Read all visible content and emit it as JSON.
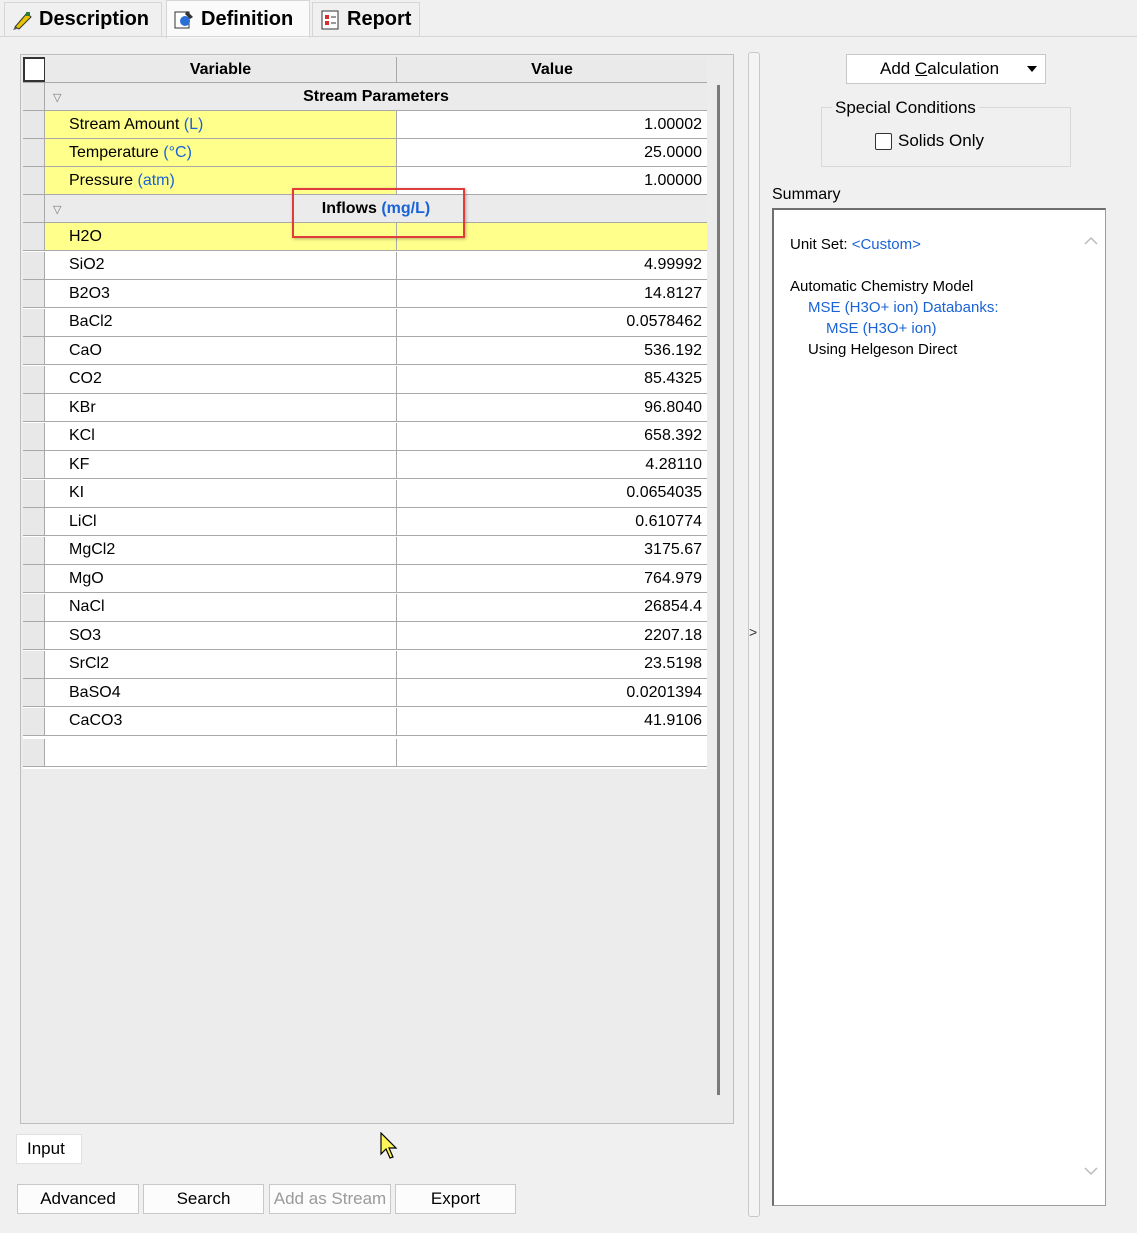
{
  "tabs": [
    {
      "label": "Description",
      "icon": "pencil-tag-icon"
    },
    {
      "label": "Definition",
      "icon": "definition-icon"
    },
    {
      "label": "Report",
      "icon": "report-icon"
    }
  ],
  "grid": {
    "col_variable": "Variable",
    "col_value": "Value",
    "section1": "Stream Parameters",
    "params": [
      {
        "name": "Stream Amount",
        "unit": "(L)",
        "value": "1.00002"
      },
      {
        "name": "Temperature",
        "unit": "(°C)",
        "value": "25.0000"
      },
      {
        "name": "Pressure",
        "unit": "(atm)",
        "value": "1.00000"
      }
    ],
    "section2_label": "Inflows",
    "section2_unit": "(mg/L)",
    "inflows": [
      {
        "name": "H2O",
        "value": ""
      },
      {
        "name": "SiO2",
        "value": "4.99992"
      },
      {
        "name": "B2O3",
        "value": "14.8127"
      },
      {
        "name": "BaCl2",
        "value": "0.0578462"
      },
      {
        "name": "CaO",
        "value": "536.192"
      },
      {
        "name": "CO2",
        "value": "85.4325"
      },
      {
        "name": "KBr",
        "value": "96.8040"
      },
      {
        "name": "KCl",
        "value": "658.392"
      },
      {
        "name": "KF",
        "value": "4.28110"
      },
      {
        "name": "KI",
        "value": "0.0654035"
      },
      {
        "name": "LiCl",
        "value": "0.610774"
      },
      {
        "name": "MgCl2",
        "value": "3175.67"
      },
      {
        "name": "MgO",
        "value": "764.979"
      },
      {
        "name": "NaCl",
        "value": "26854.4"
      },
      {
        "name": "SO3",
        "value": "2207.18"
      },
      {
        "name": "SrCl2",
        "value": "23.5198"
      },
      {
        "name": "BaSO4",
        "value": "0.0201394"
      },
      {
        "name": "CaCO3",
        "value": "41.9106"
      }
    ]
  },
  "input_tab": "Input",
  "buttons": {
    "advanced": "Advanced",
    "search": "Search",
    "add_as_stream": "Add as Stream",
    "export": "Export"
  },
  "right": {
    "add_calc_prefix": "Add ",
    "add_calc_underlined": "C",
    "add_calc_suffix": "alculation",
    "special_conditions": "Special Conditions",
    "solids_only": "Solids Only",
    "summary_label": "Summary",
    "unit_set_label": "Unit Set:",
    "unit_set_value": "<Custom>",
    "model_title": "Automatic Chemistry Model",
    "databank_line1": "MSE (H3O+ ion) Databanks:",
    "databank_line2": "MSE (H3O+ ion)",
    "using_line": "Using Helgeson Direct"
  },
  "colors": {
    "highlight_box": "#e03c3c",
    "unit_blue": "#1a63d6",
    "yellow": "#ffff8c"
  }
}
